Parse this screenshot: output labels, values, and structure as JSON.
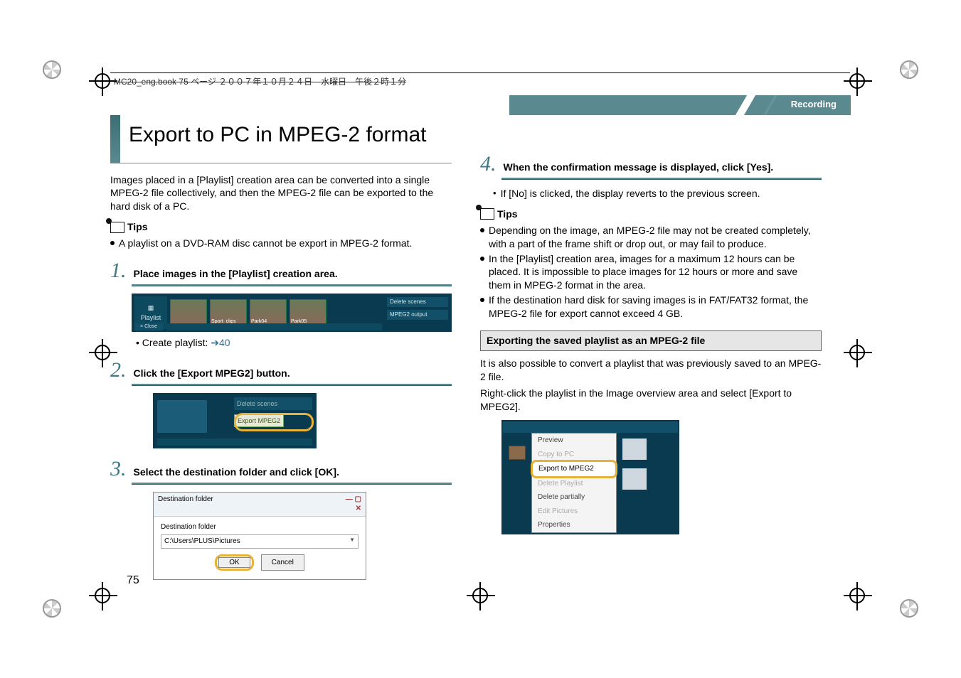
{
  "header_line": "MC20_eng.book  75 ページ  ２００７年１０月２４日　水曜日　午後２時１分",
  "section_label": "Recording",
  "page_title": "Export to PC in MPEG-2 format",
  "intro": "Images placed in a [Playlist] creation area can be converted into a single MPEG-2 file collectively, and then the MPEG-2 file can be exported to the hard disk of a PC.",
  "tips_label": "Tips",
  "tip_left": "A playlist on a DVD-RAM disc cannot be export in MPEG-2 format.",
  "step1": {
    "title": "Place images in the [Playlist] creation area."
  },
  "playlist": {
    "label": "Playlist",
    "close": "× Close",
    "clips": [
      "",
      "Sport_clips",
      "Park04",
      "Park05"
    ],
    "btn_del": "Delete scenes",
    "btn_out": "MPEG2 output"
  },
  "create_note_prefix": "• Create playlist: ",
  "create_note_link_arrow": "➔",
  "create_note_link_num": "40",
  "step2": {
    "title": "Click the [Export MPEG2] button."
  },
  "export_shot": {
    "delete": "Delete scenes",
    "export": "Export MPEG2"
  },
  "step3": {
    "title": "Select the destination folder and click [OK]."
  },
  "dialog": {
    "title": "Destination folder",
    "label": "Destination folder",
    "path": "C:\\Users\\PLUS\\Pictures",
    "ok": "OK",
    "cancel": "Cancel"
  },
  "step4": {
    "title": "When the confirmation message is displayed, click [Yes]."
  },
  "step4_sub": "If [No] is clicked, the display reverts to the previous screen.",
  "tips_right": [
    "Depending on the image, an MPEG-2 file may not be created completely, with a part of the frame shift or drop out, or may fail to produce.",
    "In the [Playlist] creation area, images for a maximum 12 hours can be placed. It is impossible to place images for 12 hours or more and save them in MPEG-2 format in the area.",
    "If the destination hard disk for saving images is in FAT/FAT32 format, the MPEG-2 file for export cannot exceed 4 GB."
  ],
  "section_heading": "Exporting the saved playlist as an MPEG-2 file",
  "sect_p1": "It is also possible to convert a playlist that was previously saved to an MPEG-2 file.",
  "sect_p2": "Right-click the playlist in the Image overview area and select [Export to MPEG2].",
  "ctx": {
    "items": [
      "Preview",
      "Copy to PC",
      "Export to MPEG2",
      "Delete Playlist",
      "Delete partially",
      "Edit Pictures",
      "Properties"
    ]
  },
  "page_number": "75",
  "num1": "1.",
  "num2": "2.",
  "num3": "3.",
  "num4": "4."
}
